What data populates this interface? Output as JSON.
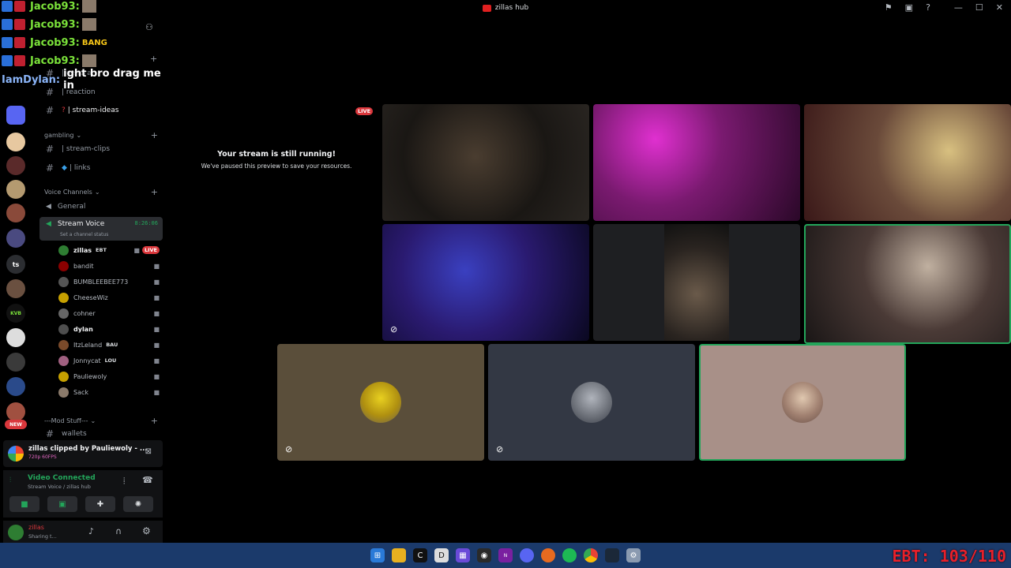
{
  "window": {
    "title": "zillas hub"
  },
  "chat_overlay": [
    {
      "user": "Jacob93:",
      "msg": ""
    },
    {
      "user": "Jacob93:",
      "msg": ""
    },
    {
      "user": "Jacob93:",
      "msg": "BANG"
    },
    {
      "user": "Jacob93:",
      "msg": ""
    },
    {
      "user": "IamDylan:",
      "msg": "ight bro drag me in"
    }
  ],
  "servers": [
    "ts",
    "KVB",
    "NEW"
  ],
  "sidebar": {
    "top_channels": [
      {
        "label": "| general"
      },
      {
        "label": "| reaction"
      },
      {
        "label": "| stream-ideas"
      }
    ],
    "gambling_category": "gambling",
    "gambling_channels": [
      {
        "label": "| stream-clips"
      },
      {
        "label": "| links"
      }
    ],
    "voice_category": "Voice Channels",
    "voice_general": "General",
    "stream_voice": {
      "label": "Stream Voice",
      "timer": "8:26:06",
      "status": "Set a channel status"
    },
    "members": [
      {
        "name": "zillas",
        "tag": "EBT",
        "live": "LIVE",
        "color": "#2e7d32"
      },
      {
        "name": "bandit",
        "tag": "",
        "live": "",
        "color": "#8b0000"
      },
      {
        "name": "BUMBLEEBEE773",
        "tag": "",
        "live": "",
        "color": "#555555"
      },
      {
        "name": "CheeseWiz",
        "tag": "",
        "live": "",
        "color": "#c6a000"
      },
      {
        "name": "cohner",
        "tag": "",
        "live": "",
        "color": "#666666"
      },
      {
        "name": "dylan",
        "tag": "",
        "live": "",
        "color": "#4e4e4e"
      },
      {
        "name": "ItzLeland",
        "tag": "BAU",
        "live": "",
        "color": "#7a4a2a"
      },
      {
        "name": "Jonnycat",
        "tag": "LOU",
        "live": "",
        "color": "#a06080"
      },
      {
        "name": "Pauliewoly",
        "tag": "",
        "live": "",
        "color": "#c6a000"
      },
      {
        "name": "Sack",
        "tag": "",
        "live": "",
        "color": "#8a7a6a"
      }
    ],
    "mod_category": "---Mod Stuff---",
    "mod_channels": [
      {
        "label": "wallets"
      }
    ]
  },
  "clip_toast": {
    "title": "zillas clipped by Pauliewoly - ...",
    "sub": "720p 60FPS"
  },
  "voice_panel": {
    "status": "Video Connected",
    "location": "Stream Voice / zillas hub"
  },
  "user_panel": {
    "name": "zillas",
    "status": "Sharing t..."
  },
  "stage": {
    "live_label": "LIVE",
    "paused_title": "Your stream is still running!",
    "paused_sub": "We've paused this preview to save your resources."
  },
  "overlay_counter": "EBT: 103/110",
  "colors": {
    "live_red": "#da373c",
    "connected_green": "#23a55a",
    "sidebar_bg": "#000000",
    "taskbar": "#1b3a6b"
  }
}
